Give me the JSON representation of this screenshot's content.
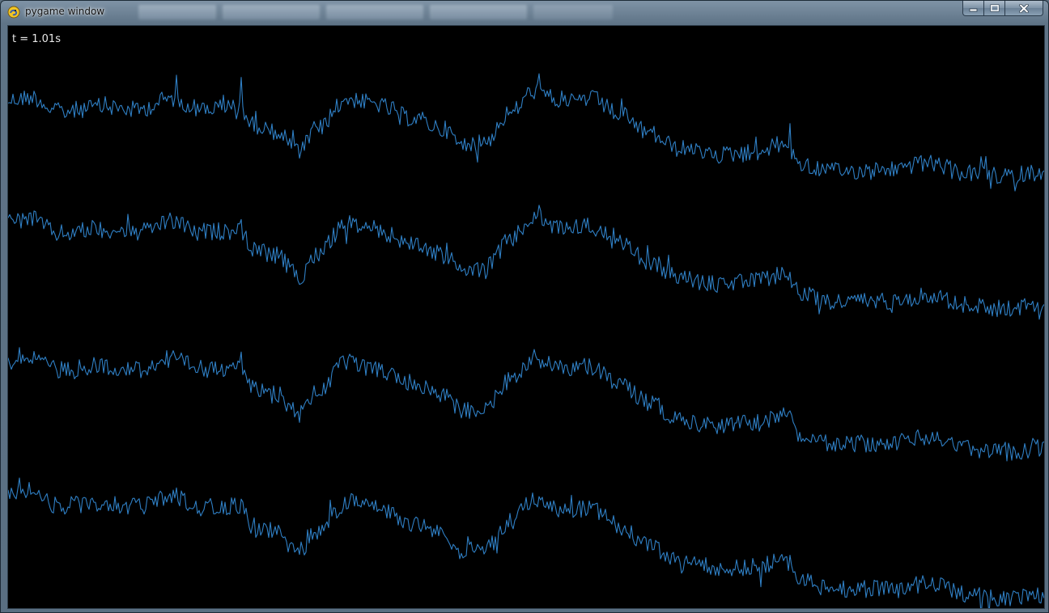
{
  "window": {
    "title": "pygame window",
    "icon": "pygame-snake-icon",
    "caption_buttons": [
      "minimize-icon",
      "maximize-icon",
      "close-icon"
    ]
  },
  "overlay": {
    "time_label": "t = 1.01s"
  },
  "style": {
    "background": "#000000",
    "wave_color": "#2f7fc4"
  },
  "chart_data": {
    "type": "line",
    "series_count": 4,
    "noisy": true,
    "grid": false
  }
}
